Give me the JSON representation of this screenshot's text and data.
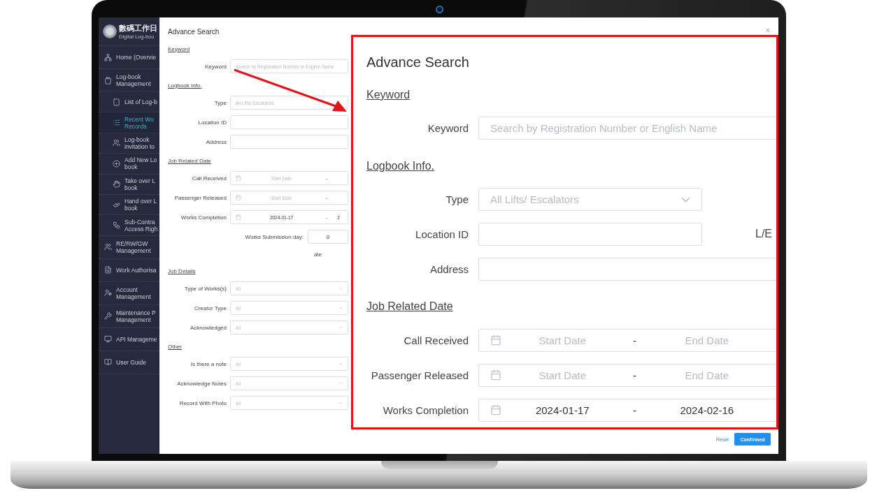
{
  "sidebar": {
    "brand_title": "數碼工作日",
    "brand_subtitle": "Digital Log-boo",
    "items": [
      {
        "label": "Home (Overvie",
        "kind": "main",
        "selected": false
      },
      {
        "label": "Log-book\nManagement",
        "kind": "main",
        "selected": false
      },
      {
        "label": "List of Log-b",
        "kind": "sub",
        "selected": false
      },
      {
        "label": "Recent Wo\nRecords",
        "kind": "sub",
        "selected": true
      },
      {
        "label": "Log-book\ninvitation to",
        "kind": "sub",
        "selected": false
      },
      {
        "label": "Add New Lo\nbook",
        "kind": "sub",
        "selected": false
      },
      {
        "label": "Take over L\nbook",
        "kind": "sub",
        "selected": false
      },
      {
        "label": "Hand over L\nbook",
        "kind": "sub",
        "selected": false
      },
      {
        "label": "Sub-Contra\nAccess Righ",
        "kind": "sub",
        "selected": false
      },
      {
        "label": "RE/RW/GW\nManagement",
        "kind": "main",
        "selected": false
      },
      {
        "label": "Work Authorisa",
        "kind": "main",
        "selected": false
      },
      {
        "label": "Account\nManagement",
        "kind": "main",
        "selected": false
      },
      {
        "label": "Maintenance P\nManagement",
        "kind": "main",
        "selected": false
      },
      {
        "label": "API Manageme",
        "kind": "main",
        "selected": false
      },
      {
        "label": "User Guide",
        "kind": "main",
        "selected": false
      }
    ]
  },
  "modal": {
    "title": "Advance Search",
    "close": "×",
    "rows": [
      {
        "kind": "heading",
        "label": "Keyword"
      },
      {
        "kind": "text",
        "label": "Keyword",
        "placeholder": "Search by Registration Number or English Name"
      },
      {
        "kind": "heading",
        "label": "Logbook Info."
      },
      {
        "kind": "select",
        "label": "Type",
        "placeholder": "All Lifts/ Escalators",
        "chevron": false
      },
      {
        "kind": "text",
        "label": "Location ID"
      },
      {
        "kind": "text",
        "label": "Address"
      },
      {
        "kind": "heading",
        "label": "Job Related Date"
      },
      {
        "kind": "date",
        "label": "Call Received",
        "start_placeholder": "Start Date",
        "dash": "-"
      },
      {
        "kind": "date",
        "label": "Passenger Released",
        "start_placeholder": "Start Date",
        "dash": "-"
      },
      {
        "kind": "date",
        "label": "Works Completion",
        "start": "2024-01-17",
        "dash": "-",
        "end": "2"
      },
      {
        "kind": "number",
        "label": "Works Submission day:",
        "value": "0"
      },
      {
        "kind": "note",
        "label": "ate"
      },
      {
        "kind": "heading",
        "label": "Job Details"
      },
      {
        "kind": "select",
        "label": "Type of Works(s)",
        "placeholder": "All",
        "chevron": true
      },
      {
        "kind": "select",
        "label": "Creator Type",
        "placeholder": "All",
        "chevron": true
      },
      {
        "kind": "select",
        "label": "Acknowledged",
        "placeholder": "All",
        "chevron": true
      },
      {
        "kind": "heading",
        "label": "Other"
      },
      {
        "kind": "select",
        "label": "Is there a note",
        "placeholder": "All",
        "chevron": true
      },
      {
        "kind": "select",
        "label": "Acknowledge Notes",
        "placeholder": "All",
        "chevron": true
      },
      {
        "kind": "select",
        "label": "Record With Photo",
        "placeholder": "All",
        "chevron": true
      }
    ],
    "buttons": [
      {
        "label": "Reset",
        "kind": "link"
      },
      {
        "label": "Confirmed",
        "kind": "primary"
      }
    ]
  },
  "callout": {
    "title": "Advance Search",
    "rows": [
      {
        "kind": "heading",
        "label": "Keyword"
      },
      {
        "kind": "text",
        "label": "Keyword",
        "placeholder": "Search by Registration Number or English Name",
        "wide": true
      },
      {
        "kind": "heading",
        "label": "Logbook Info."
      },
      {
        "kind": "select",
        "label": "Type",
        "placeholder": "All Lifts/ Escalators",
        "chevron": true
      },
      {
        "kind": "text",
        "label": "Location ID",
        "wide": false,
        "suffix": "L/E"
      },
      {
        "kind": "text",
        "label": "Address",
        "wide": true
      },
      {
        "kind": "heading",
        "label": "Job Related Date"
      },
      {
        "kind": "date",
        "label": "Call Received",
        "start_placeholder": "Start Date",
        "dash": "-",
        "end_placeholder": "End Date"
      },
      {
        "kind": "date",
        "label": "Passenger Released",
        "start_placeholder": "Start Date",
        "dash": "-",
        "end_placeholder": "End Date"
      },
      {
        "kind": "date",
        "label": "Works Completion",
        "start": "2024-01-17",
        "dash": "-",
        "end": "2024-02-16"
      }
    ]
  }
}
